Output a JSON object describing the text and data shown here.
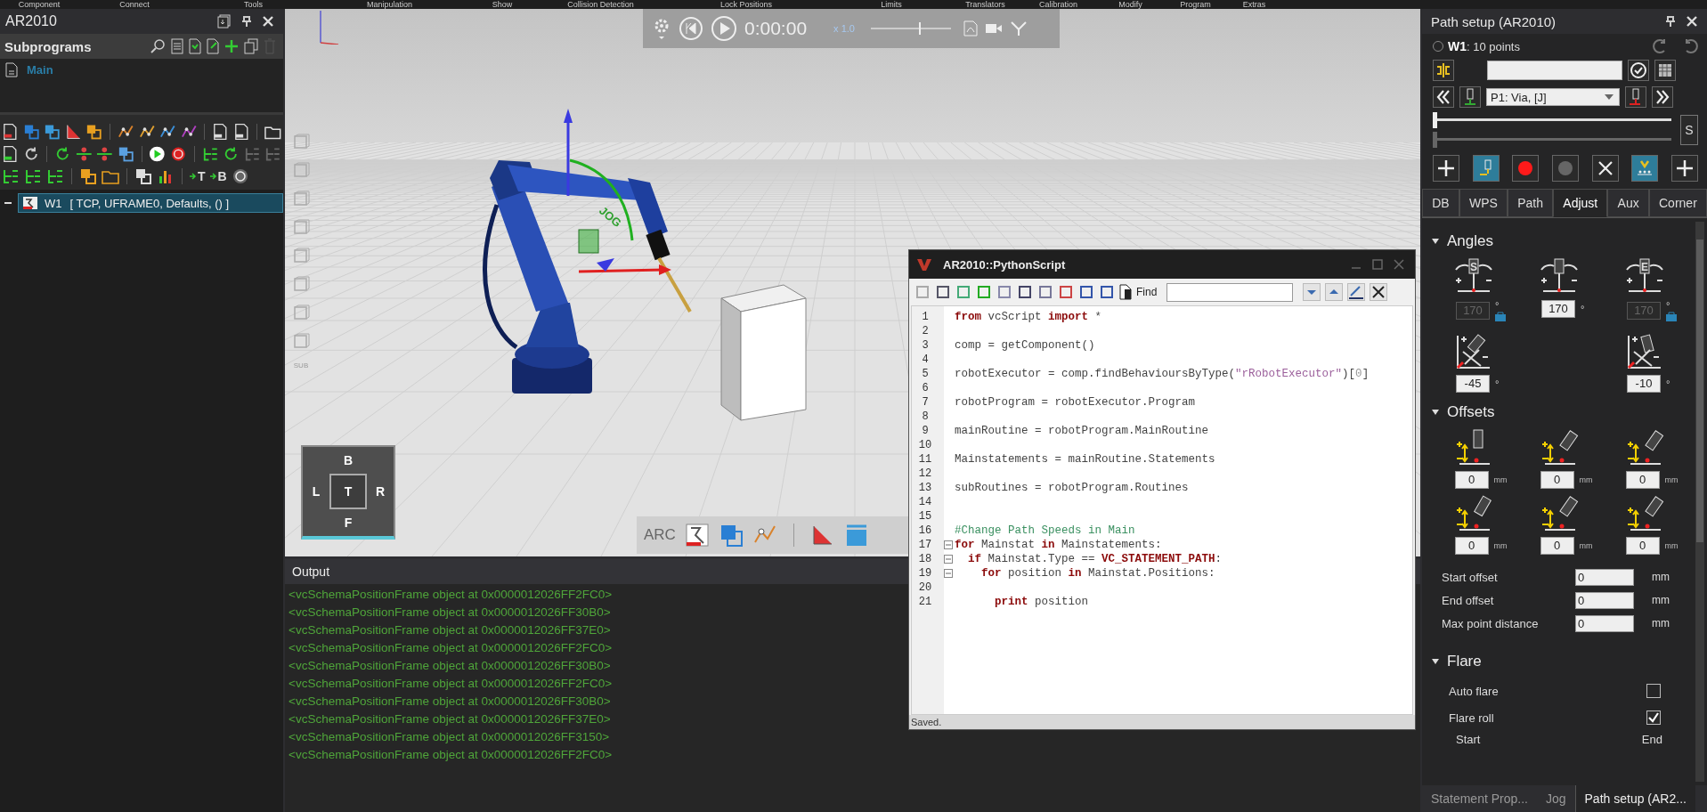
{
  "menu_bar": [
    "Component",
    "Connect",
    "Tools",
    "Manipulation",
    "Show",
    "Collision Detection",
    "Lock Positions",
    "Limits",
    "Translators",
    "Calibration",
    "Modify",
    "Program",
    "Extras"
  ],
  "left_panel": {
    "title": "AR2010",
    "subprograms": {
      "title": "Subprograms",
      "items": [
        {
          "label": "Main",
          "selected": true
        }
      ]
    },
    "toolbar_labels": [
      "T",
      "B"
    ],
    "tree": [
      {
        "label": "W1",
        "detail": "[ TCP, UFRAME0, Defaults, () ]",
        "expanded": true,
        "selected": true
      }
    ]
  },
  "viewport": {
    "playback": {
      "time": "0:00:00",
      "speed": "x 1.0",
      "level": 0.6
    },
    "gizmo_label": "JOG",
    "side_label": "SUB",
    "view_cube": {
      "top": "B",
      "left": "L",
      "center": "T",
      "right": "R",
      "bottom": "F"
    },
    "bottom_toolbar_label": "ARC"
  },
  "script_editor": {
    "title": "AR2010::PythonScript",
    "find_label": "Find",
    "status": "Saved.",
    "lines": [
      {
        "number": "1",
        "fold": false,
        "tokens": [
          {
            "kind": "keyword",
            "text": "from"
          },
          {
            "kind": "plain",
            "text": " vcScript "
          },
          {
            "kind": "keyword",
            "text": "import"
          },
          {
            "kind": "plain",
            "text": " *"
          }
        ]
      },
      {
        "number": "2",
        "fold": false
      },
      {
        "number": "3",
        "fold": false,
        "tokens": [
          {
            "kind": "plain",
            "text": "comp = getComponent()"
          }
        ]
      },
      {
        "number": "4",
        "fold": false
      },
      {
        "number": "5",
        "fold": false,
        "tokens": [
          {
            "kind": "plain",
            "text": "robotExecutor = comp.findBehavioursByType("
          },
          {
            "kind": "string",
            "text": "\"rRobotExecutor\""
          },
          {
            "kind": "plain",
            "text": ")["
          },
          {
            "kind": "number",
            "text": "0"
          },
          {
            "kind": "plain",
            "text": "]"
          }
        ]
      },
      {
        "number": "6",
        "fold": false
      },
      {
        "number": "7",
        "fold": false,
        "tokens": [
          {
            "kind": "plain",
            "text": "robotProgram = robotExecutor.Program"
          }
        ]
      },
      {
        "number": "8",
        "fold": false
      },
      {
        "number": "9",
        "fold": false,
        "tokens": [
          {
            "kind": "plain",
            "text": "mainRoutine = robotProgram.MainRoutine"
          }
        ]
      },
      {
        "number": "10",
        "fold": false
      },
      {
        "number": "11",
        "fold": false,
        "tokens": [
          {
            "kind": "plain",
            "text": "Mainstatements = mainRoutine.Statements"
          }
        ]
      },
      {
        "number": "12",
        "fold": false
      },
      {
        "number": "13",
        "fold": false,
        "tokens": [
          {
            "kind": "plain",
            "text": "subRoutines = robotProgram.Routines"
          }
        ]
      },
      {
        "number": "14",
        "fold": false
      },
      {
        "number": "15",
        "fold": false
      },
      {
        "number": "16",
        "fold": false,
        "tokens": [
          {
            "kind": "comment",
            "text": "#Change Path Speeds in Main"
          }
        ]
      },
      {
        "number": "17",
        "fold": true,
        "tokens": [
          {
            "kind": "keyword",
            "text": "for"
          },
          {
            "kind": "plain",
            "text": " Mainstat "
          },
          {
            "kind": "keyword",
            "text": "in"
          },
          {
            "kind": "plain",
            "text": " Mainstatements:"
          }
        ]
      },
      {
        "number": "18",
        "fold": true,
        "tokens": [
          {
            "kind": "keyword",
            "text": "  if"
          },
          {
            "kind": "plain",
            "text": " Mainstat.Type == "
          },
          {
            "kind": "constant",
            "text": "VC_STATEMENT_PATH"
          },
          {
            "kind": "plain",
            "text": ":"
          }
        ]
      },
      {
        "number": "19",
        "fold": true,
        "tokens": [
          {
            "kind": "keyword",
            "text": "    for"
          },
          {
            "kind": "plain",
            "text": " position "
          },
          {
            "kind": "keyword",
            "text": "in"
          },
          {
            "kind": "plain",
            "text": " Mainstat.Positions:"
          }
        ]
      },
      {
        "number": "20",
        "fold": false
      },
      {
        "number": "21",
        "fold": false,
        "tokens": [
          {
            "kind": "keyword",
            "text": "      print"
          },
          {
            "kind": "plain",
            "text": " position"
          }
        ]
      }
    ]
  },
  "output": {
    "title": "Output",
    "lines": [
      "<vcSchemaPositionFrame object at 0x0000012026FF2FC0>",
      "<vcSchemaPositionFrame object at 0x0000012026FF30B0>",
      "<vcSchemaPositionFrame object at 0x0000012026FF37E0>",
      "<vcSchemaPositionFrame object at 0x0000012026FF2FC0>",
      "<vcSchemaPositionFrame object at 0x0000012026FF30B0>",
      "<vcSchemaPositionFrame object at 0x0000012026FF2FC0>",
      "<vcSchemaPositionFrame object at 0x0000012026FF30B0>",
      "<vcSchemaPositionFrame object at 0x0000012026FF37E0>",
      "<vcSchemaPositionFrame object at 0x0000012026FF3150>",
      "<vcSchemaPositionFrame object at 0x0000012026FF2FC0>"
    ]
  },
  "path_setup": {
    "title": "Path setup (AR2010)",
    "path": {
      "label": "**W1**: 10 points",
      "selected": false
    },
    "point": "P1: Via, [J]",
    "sliders": [
      {
        "level": 0,
        "disabled": false
      },
      {
        "level": 0,
        "disabled": true
      }
    ],
    "speed_button": "S",
    "actions": [
      {
        "kind": "add",
        "on": false
      },
      {
        "kind": "touch",
        "on": true
      },
      {
        "kind": "record",
        "on": false
      },
      {
        "kind": "stop",
        "on": false
      },
      {
        "kind": "delete",
        "on": false
      },
      {
        "kind": "verify",
        "on": true
      },
      {
        "kind": "add",
        "on": false
      }
    ],
    "tabs": [
      {
        "label": "DB",
        "selected": false
      },
      {
        "label": "WPS",
        "selected": false
      },
      {
        "label": "Path",
        "selected": false
      },
      {
        "label": "Adjust",
        "selected": true
      },
      {
        "label": "Aux",
        "selected": false
      },
      {
        "label": "Corner",
        "selected": false
      }
    ],
    "angles": {
      "title": "Angles",
      "expanded": true,
      "fields": [
        {
          "marker": "S",
          "value": "170",
          "unit": "°",
          "disabled": true,
          "locked": true
        },
        {
          "value": "170",
          "unit": "°",
          "disabled": false,
          "locked": false
        },
        {
          "marker": "E",
          "value": "170",
          "unit": "°",
          "disabled": true,
          "locked": true
        }
      ],
      "tilts": [
        {
          "value": "-45",
          "unit": "°"
        },
        {
          "value": "-10",
          "unit": "°"
        }
      ]
    },
    "offsets": {
      "title": "Offsets",
      "expanded": true,
      "fields": [
        {
          "value": "0",
          "unit": "mm"
        },
        {
          "value": "0",
          "unit": "mm"
        },
        {
          "value": "0",
          "unit": "mm"
        },
        {
          "value": "0",
          "unit": "mm"
        },
        {
          "value": "0",
          "unit": "mm"
        },
        {
          "value": "0",
          "unit": "mm"
        }
      ],
      "rows": [
        {
          "label": "Start offset",
          "value": "0",
          "unit": "mm"
        },
        {
          "label": "End offset",
          "value": "0",
          "unit": "mm"
        },
        {
          "label": "Max point distance",
          "value": "0",
          "unit": "mm"
        }
      ]
    },
    "flare": {
      "title": "Flare",
      "expanded": true,
      "options": [
        {
          "label": "Auto flare",
          "checked": false
        },
        {
          "label": "Flare roll",
          "checked": true
        }
      ],
      "start_label": "Start",
      "end_label": "End"
    },
    "bottom_tabs": [
      {
        "label": "Statement Prop...",
        "selected": false
      },
      {
        "label": "Jog",
        "selected": false
      },
      {
        "label": "Path setup (AR2...",
        "selected": true
      }
    ]
  }
}
